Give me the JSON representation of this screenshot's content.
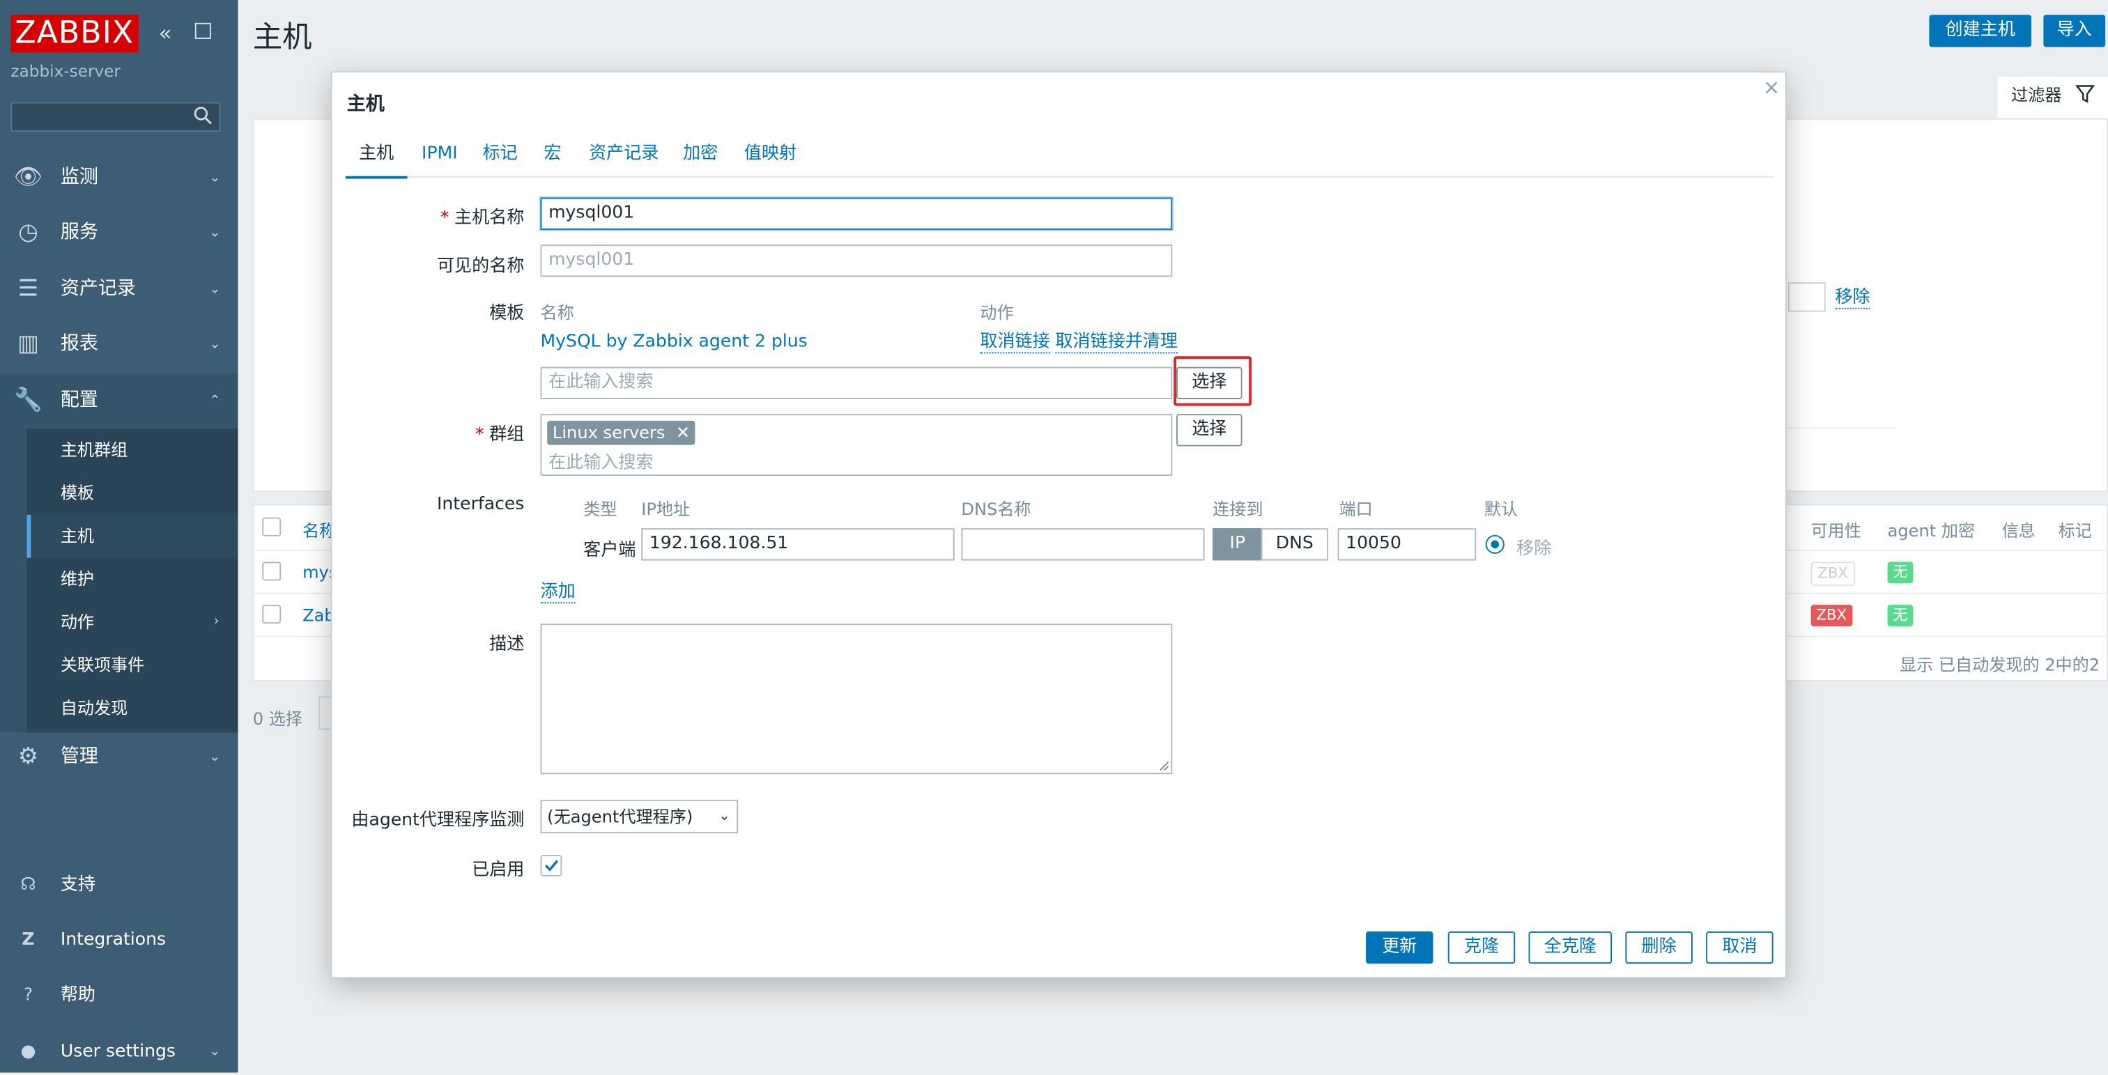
{
  "sidebar": {
    "logo": "ZABBIX",
    "server_name": "zabbix-server",
    "menu": [
      {
        "label": "监测"
      },
      {
        "label": "服务"
      },
      {
        "label": "资产记录"
      },
      {
        "label": "报表"
      },
      {
        "label": "配置"
      },
      {
        "label": "管理"
      }
    ],
    "submenu": [
      "主机群组",
      "模板",
      "主机",
      "维护",
      "动作",
      "关联项事件",
      "自动发现"
    ],
    "bottom": [
      "支持",
      "Integrations",
      "帮助",
      "User settings"
    ]
  },
  "page": {
    "title": "主机",
    "create_button": "创建主机",
    "import_button": "导入",
    "filter_tab": "过滤器",
    "remove_link": "移除",
    "columns": {
      "name": "名称",
      "availability": "可用性",
      "agent_encryption": "agent 加密",
      "info": "信息",
      "tags": "标记"
    },
    "rows": [
      {
        "name": "mys",
        "availability": "ZBX",
        "encryption": "无"
      },
      {
        "name": "Zab",
        "availability": "ZBX",
        "encryption": "无"
      }
    ],
    "footer_count": "显示 已自动发现的 2中的2",
    "selected": "0 选择"
  },
  "modal": {
    "title": "主机",
    "close": "×",
    "tabs": [
      "主机",
      "IPMI",
      "标记",
      "宏",
      "资产记录",
      "加密",
      "值映射"
    ],
    "host_name_label": "主机名称",
    "host_name_value": "mysql001",
    "visible_name_label": "可见的名称",
    "visible_name_placeholder": "mysql001",
    "templates_label": "模板",
    "templates_col_name": "名称",
    "templates_col_action": "动作",
    "template_name": "MySQL by Zabbix agent 2 plus",
    "unlink": "取消链接",
    "unlink_clear": "取消链接并清理",
    "search_placeholder": "在此输入搜索",
    "select_button": "选择",
    "groups_label": "群组",
    "group_tag": "Linux servers",
    "interfaces_label": "Interfaces",
    "iface_cols": {
      "type": "类型",
      "ip": "IP地址",
      "dns": "DNS名称",
      "connect": "连接到",
      "port": "端口",
      "default": "默认"
    },
    "iface": {
      "type": "客户端",
      "ip": "192.168.108.51",
      "dns": "",
      "port": "10050",
      "remove": "移除"
    },
    "connect_ip": "IP",
    "connect_dns": "DNS",
    "add_link": "添加",
    "description_label": "描述",
    "proxy_label": "由agent代理程序监测",
    "proxy_value": "(无agent代理程序)",
    "enabled_label": "已启用",
    "enabled": true,
    "buttons": {
      "update": "更新",
      "clone": "克隆",
      "full_clone": "全克隆",
      "delete": "删除",
      "cancel": "取消"
    }
  },
  "colors": {
    "accent": "#0275b8",
    "sidebar": "#3c5d73",
    "logo": "#d40000",
    "highlight": "#e0262b"
  }
}
